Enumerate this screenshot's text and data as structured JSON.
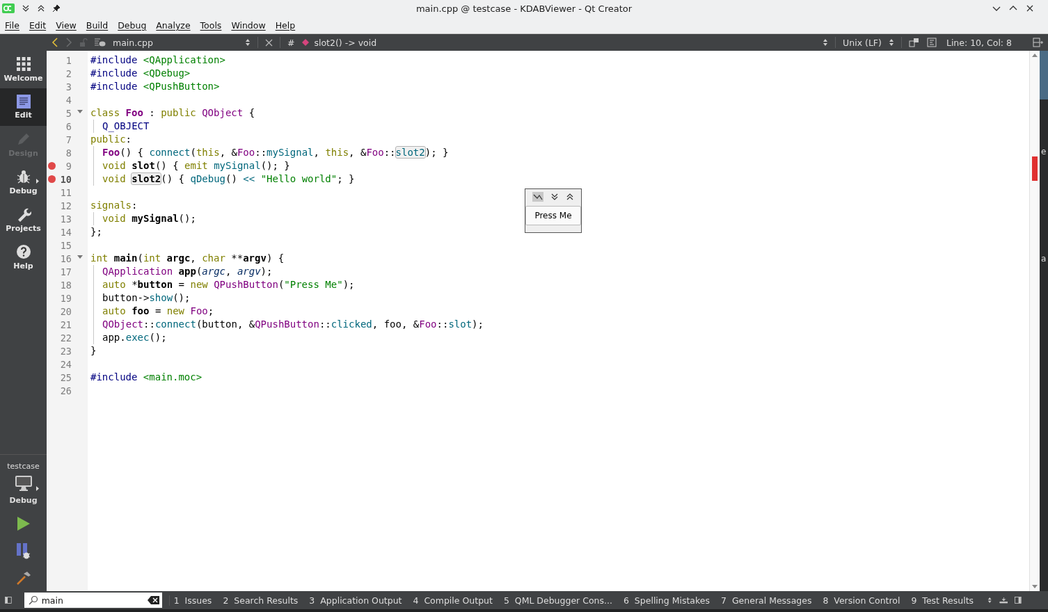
{
  "window": {
    "title": "main.cpp @ testcase - KDABViewer - Qt Creator"
  },
  "menu": [
    "File",
    "Edit",
    "View",
    "Build",
    "Debug",
    "Analyze",
    "Tools",
    "Window",
    "Help"
  ],
  "toolbar": {
    "file": "main.cpp",
    "symbol": "slot2() -> void",
    "symbol_separator": "#",
    "line_ending": "Unix (LF)",
    "position": "Line: 10, Col: 8"
  },
  "modes": [
    {
      "label": "Welcome",
      "kind": "grid",
      "selected": false,
      "disabled": false,
      "has_menu": false
    },
    {
      "label": "Edit",
      "kind": "edit",
      "selected": true,
      "disabled": false,
      "has_menu": false
    },
    {
      "label": "Design",
      "kind": "pencil",
      "selected": false,
      "disabled": true,
      "has_menu": false
    },
    {
      "label": "Debug",
      "kind": "bug",
      "selected": false,
      "disabled": false,
      "has_menu": true
    },
    {
      "label": "Projects",
      "kind": "wrench",
      "selected": false,
      "disabled": false,
      "has_menu": false
    },
    {
      "label": "Help",
      "kind": "help",
      "selected": false,
      "disabled": false,
      "has_menu": false
    }
  ],
  "target": {
    "project": "testcase",
    "build": "Debug"
  },
  "code": [
    {
      "number": "1",
      "breakpoint": false,
      "fold": false,
      "current": false,
      "indent": false,
      "tokens": [
        {
          "kind": "pp",
          "text": "#include"
        },
        {
          "kind": "inc",
          "text": " <QApplication>"
        }
      ]
    },
    {
      "number": "2",
      "breakpoint": false,
      "fold": false,
      "current": false,
      "indent": false,
      "tokens": [
        {
          "kind": "pp",
          "text": "#include"
        },
        {
          "kind": "inc",
          "text": " <QDebug>"
        }
      ]
    },
    {
      "number": "3",
      "breakpoint": false,
      "fold": false,
      "current": false,
      "indent": false,
      "tokens": [
        {
          "kind": "pp",
          "text": "#include"
        },
        {
          "kind": "inc",
          "text": " <QPushButton>"
        }
      ]
    },
    {
      "number": "4",
      "breakpoint": false,
      "fold": false,
      "current": false,
      "indent": false
    },
    {
      "number": "5",
      "breakpoint": false,
      "fold": true,
      "current": false,
      "indent": false,
      "tokens": [
        {
          "kind": "kw",
          "text": "class "
        },
        {
          "kind": "decltype",
          "text": "Foo"
        },
        {
          "kind": "plain",
          "text": " : "
        },
        {
          "kind": "kw",
          "text": "public "
        },
        {
          "kind": "type",
          "text": "QObject"
        },
        {
          "kind": "plain",
          "text": " {"
        }
      ]
    },
    {
      "number": "6",
      "breakpoint": false,
      "fold": false,
      "current": false,
      "indent": true,
      "tokens": [
        {
          "kind": "pp",
          "text": "Q_OBJECT"
        }
      ]
    },
    {
      "number": "7",
      "breakpoint": false,
      "fold": false,
      "current": false,
      "indent": false,
      "tokens": [
        {
          "kind": "kw",
          "text": "public"
        },
        {
          "kind": "plain",
          "text": ":"
        }
      ]
    },
    {
      "number": "8",
      "breakpoint": false,
      "fold": false,
      "current": false,
      "indent": true,
      "tokens": [
        {
          "kind": "decltype",
          "text": "Foo"
        },
        {
          "kind": "plain",
          "text": "() { "
        },
        {
          "kind": "fn",
          "text": "connect"
        },
        {
          "kind": "plain",
          "text": "("
        },
        {
          "kind": "kw",
          "text": "this"
        },
        {
          "kind": "plain",
          "text": ", &"
        },
        {
          "kind": "type",
          "text": "Foo"
        },
        {
          "kind": "plain",
          "text": "::"
        },
        {
          "kind": "fn",
          "text": "mySignal"
        },
        {
          "kind": "plain",
          "text": ", "
        },
        {
          "kind": "kw",
          "text": "this"
        },
        {
          "kind": "plain",
          "text": ", &"
        },
        {
          "kind": "type",
          "text": "Foo"
        },
        {
          "kind": "plain",
          "text": "::"
        },
        {
          "kind": "fnhl",
          "text": "slot2"
        },
        {
          "kind": "plain",
          "text": "); }"
        }
      ]
    },
    {
      "number": "9",
      "breakpoint": true,
      "fold": false,
      "current": false,
      "indent": true,
      "tokens": [
        {
          "kind": "kw",
          "text": "void "
        },
        {
          "kind": "decl",
          "text": "slot"
        },
        {
          "kind": "plain",
          "text": "() { "
        },
        {
          "kind": "kw",
          "text": "emit "
        },
        {
          "kind": "fn",
          "text": "mySignal"
        },
        {
          "kind": "plain",
          "text": "(); }"
        }
      ]
    },
    {
      "number": "10",
      "breakpoint": true,
      "fold": false,
      "current": true,
      "indent": true,
      "tokens": [
        {
          "kind": "kw",
          "text": "void "
        },
        {
          "kind": "declhl",
          "text": "slot2"
        },
        {
          "kind": "plain",
          "text": "() { "
        },
        {
          "kind": "fn",
          "text": "qDebug"
        },
        {
          "kind": "plain",
          "text": "() "
        },
        {
          "kind": "fn",
          "text": "<<"
        },
        {
          "kind": "str",
          "text": " \"Hello world\""
        },
        {
          "kind": "plain",
          "text": "; }"
        }
      ]
    },
    {
      "number": "11",
      "breakpoint": false,
      "fold": false,
      "current": false,
      "indent": false
    },
    {
      "number": "12",
      "breakpoint": false,
      "fold": false,
      "current": false,
      "indent": false,
      "tokens": [
        {
          "kind": "kw",
          "text": "signals"
        },
        {
          "kind": "plain",
          "text": ":"
        }
      ]
    },
    {
      "number": "13",
      "breakpoint": false,
      "fold": false,
      "current": false,
      "indent": true,
      "tokens": [
        {
          "kind": "kw",
          "text": "void "
        },
        {
          "kind": "decl",
          "text": "mySignal"
        },
        {
          "kind": "plain",
          "text": "();"
        }
      ]
    },
    {
      "number": "14",
      "breakpoint": false,
      "fold": false,
      "current": false,
      "indent": false,
      "tokens": [
        {
          "kind": "plain",
          "text": "};"
        }
      ]
    },
    {
      "number": "15",
      "breakpoint": false,
      "fold": false,
      "current": false,
      "indent": false
    },
    {
      "number": "16",
      "breakpoint": false,
      "fold": true,
      "current": false,
      "indent": false,
      "tokens": [
        {
          "kind": "kw",
          "text": "int "
        },
        {
          "kind": "decl",
          "text": "main"
        },
        {
          "kind": "plain",
          "text": "("
        },
        {
          "kind": "kw",
          "text": "int "
        },
        {
          "kind": "decl",
          "text": "argc"
        },
        {
          "kind": "plain",
          "text": ", "
        },
        {
          "kind": "kw",
          "text": "char"
        },
        {
          "kind": "plain",
          "text": " **"
        },
        {
          "kind": "decl",
          "text": "argv"
        },
        {
          "kind": "plain",
          "text": ") {"
        }
      ]
    },
    {
      "number": "17",
      "breakpoint": false,
      "fold": false,
      "current": false,
      "indent": true,
      "tokens": [
        {
          "kind": "type",
          "text": "QApplication "
        },
        {
          "kind": "decl",
          "text": "app"
        },
        {
          "kind": "plain",
          "text": "("
        },
        {
          "kind": "param",
          "text": "argc"
        },
        {
          "kind": "plain",
          "text": ", "
        },
        {
          "kind": "param",
          "text": "argv"
        },
        {
          "kind": "plain",
          "text": ");"
        }
      ]
    },
    {
      "number": "18",
      "breakpoint": false,
      "fold": false,
      "current": false,
      "indent": true,
      "tokens": [
        {
          "kind": "kw",
          "text": "auto"
        },
        {
          "kind": "plain",
          "text": " *"
        },
        {
          "kind": "decl",
          "text": "button"
        },
        {
          "kind": "plain",
          "text": " = "
        },
        {
          "kind": "kw",
          "text": "new "
        },
        {
          "kind": "type",
          "text": "QPushButton"
        },
        {
          "kind": "plain",
          "text": "("
        },
        {
          "kind": "str",
          "text": "\"Press Me\""
        },
        {
          "kind": "plain",
          "text": ");"
        }
      ]
    },
    {
      "number": "19",
      "breakpoint": false,
      "fold": false,
      "current": false,
      "indent": true,
      "tokens": [
        {
          "kind": "plain",
          "text": "button->"
        },
        {
          "kind": "fn",
          "text": "show"
        },
        {
          "kind": "plain",
          "text": "();"
        }
      ]
    },
    {
      "number": "20",
      "breakpoint": false,
      "fold": false,
      "current": false,
      "indent": true,
      "tokens": [
        {
          "kind": "kw",
          "text": "auto "
        },
        {
          "kind": "decl",
          "text": "foo"
        },
        {
          "kind": "plain",
          "text": " = "
        },
        {
          "kind": "kw",
          "text": "new "
        },
        {
          "kind": "type",
          "text": "Foo"
        },
        {
          "kind": "plain",
          "text": ";"
        }
      ]
    },
    {
      "number": "21",
      "breakpoint": false,
      "fold": false,
      "current": false,
      "indent": true,
      "tokens": [
        {
          "kind": "type",
          "text": "QObject"
        },
        {
          "kind": "plain",
          "text": "::"
        },
        {
          "kind": "fn",
          "text": "connect"
        },
        {
          "kind": "plain",
          "text": "(button, &"
        },
        {
          "kind": "type",
          "text": "QPushButton"
        },
        {
          "kind": "plain",
          "text": "::"
        },
        {
          "kind": "fn",
          "text": "clicked"
        },
        {
          "kind": "plain",
          "text": ", foo, &"
        },
        {
          "kind": "type",
          "text": "Foo"
        },
        {
          "kind": "plain",
          "text": "::"
        },
        {
          "kind": "fn",
          "text": "slot"
        },
        {
          "kind": "plain",
          "text": ");"
        }
      ]
    },
    {
      "number": "22",
      "breakpoint": false,
      "fold": false,
      "current": false,
      "indent": true,
      "tokens": [
        {
          "kind": "plain",
          "text": "app."
        },
        {
          "kind": "fn",
          "text": "exec"
        },
        {
          "kind": "plain",
          "text": "();"
        }
      ]
    },
    {
      "number": "23",
      "breakpoint": false,
      "fold": false,
      "current": false,
      "indent": false,
      "tokens": [
        {
          "kind": "plain",
          "text": "}"
        }
      ]
    },
    {
      "number": "24",
      "breakpoint": false,
      "fold": false,
      "current": false,
      "indent": false
    },
    {
      "number": "25",
      "breakpoint": false,
      "fold": false,
      "current": false,
      "indent": false,
      "tokens": [
        {
          "kind": "pp",
          "text": "#include"
        },
        {
          "kind": "inc",
          "text": " <main.moc>"
        }
      ]
    },
    {
      "number": "26",
      "breakpoint": false,
      "fold": false,
      "current": false,
      "indent": false
    }
  ],
  "popup": {
    "button": "Press Me"
  },
  "background_window_letters": [
    "e",
    "a"
  ],
  "output_filter": {
    "value": "main"
  },
  "output_panes": [
    {
      "number": "1",
      "label": "Issues"
    },
    {
      "number": "2",
      "label": "Search Results"
    },
    {
      "number": "3",
      "label": "Application Output"
    },
    {
      "number": "4",
      "label": "Compile Output"
    },
    {
      "number": "5",
      "label": "QML Debugger Cons..."
    },
    {
      "number": "6",
      "label": "Spelling Mistakes"
    },
    {
      "number": "7",
      "label": "General Messages"
    },
    {
      "number": "8",
      "label": "Version Control"
    },
    {
      "number": "9",
      "label": "Test Results"
    }
  ]
}
